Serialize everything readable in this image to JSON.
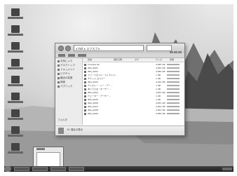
{
  "desktop": {
    "icon_count": 9,
    "taskbar": {
      "buttons": 4
    }
  },
  "window": {
    "address": "◂ Volt ▸ エクスプ ▸",
    "navigation": [
      {
        "label": "お気に入り"
      },
      {
        "label": "デスクトップ"
      },
      {
        "label": "ドキュメント"
      },
      {
        "label": "ピクチャ"
      },
      {
        "label": "最近の変更"
      },
      {
        "label": "検索"
      },
      {
        "label": "パブリック"
      }
    ],
    "columns": [
      "名前",
      "撮影日時",
      "タグ",
      "サイズ",
      "評価"
    ],
    "files": [
      {
        "name": "Thumbs.db",
        "size": "4,887 KB"
      },
      {
        "name": "IMG_0001",
        "size": "4,857 KB"
      },
      {
        "name": "IMG_0002",
        "size": "4,887 KB"
      },
      {
        "name": "フリースタイル・ストラトス…",
        "size": "1 KB"
      },
      {
        "name": "チケット_セミナー",
        "size": "1 KB"
      },
      {
        "name": "IMG_0003",
        "size": "4,957 KB"
      },
      {
        "name": "ディズニー・シー・アー…",
        "size": "1 KB"
      },
      {
        "name": "あいうえお・オーサー…",
        "size": "1 KB"
      },
      {
        "name": "IMG_0004",
        "size": "4,857 KB"
      },
      {
        "name": "ウェーダー・アーサー…",
        "size": "1 KB"
      },
      {
        "name": "IMG_0005",
        "size": "1 KB"
      },
      {
        "name": "IMG_0006",
        "size": "4,857 KB"
      },
      {
        "name": "IMG_0007",
        "size": "4,857 KB"
      },
      {
        "name": "IMG_0008",
        "size": "4,857 KB"
      },
      {
        "name": "IMG_0009",
        "size": "4,887 KB"
      }
    ],
    "folder_label": "フォルダ",
    "details_text": "15 項目の表示"
  }
}
